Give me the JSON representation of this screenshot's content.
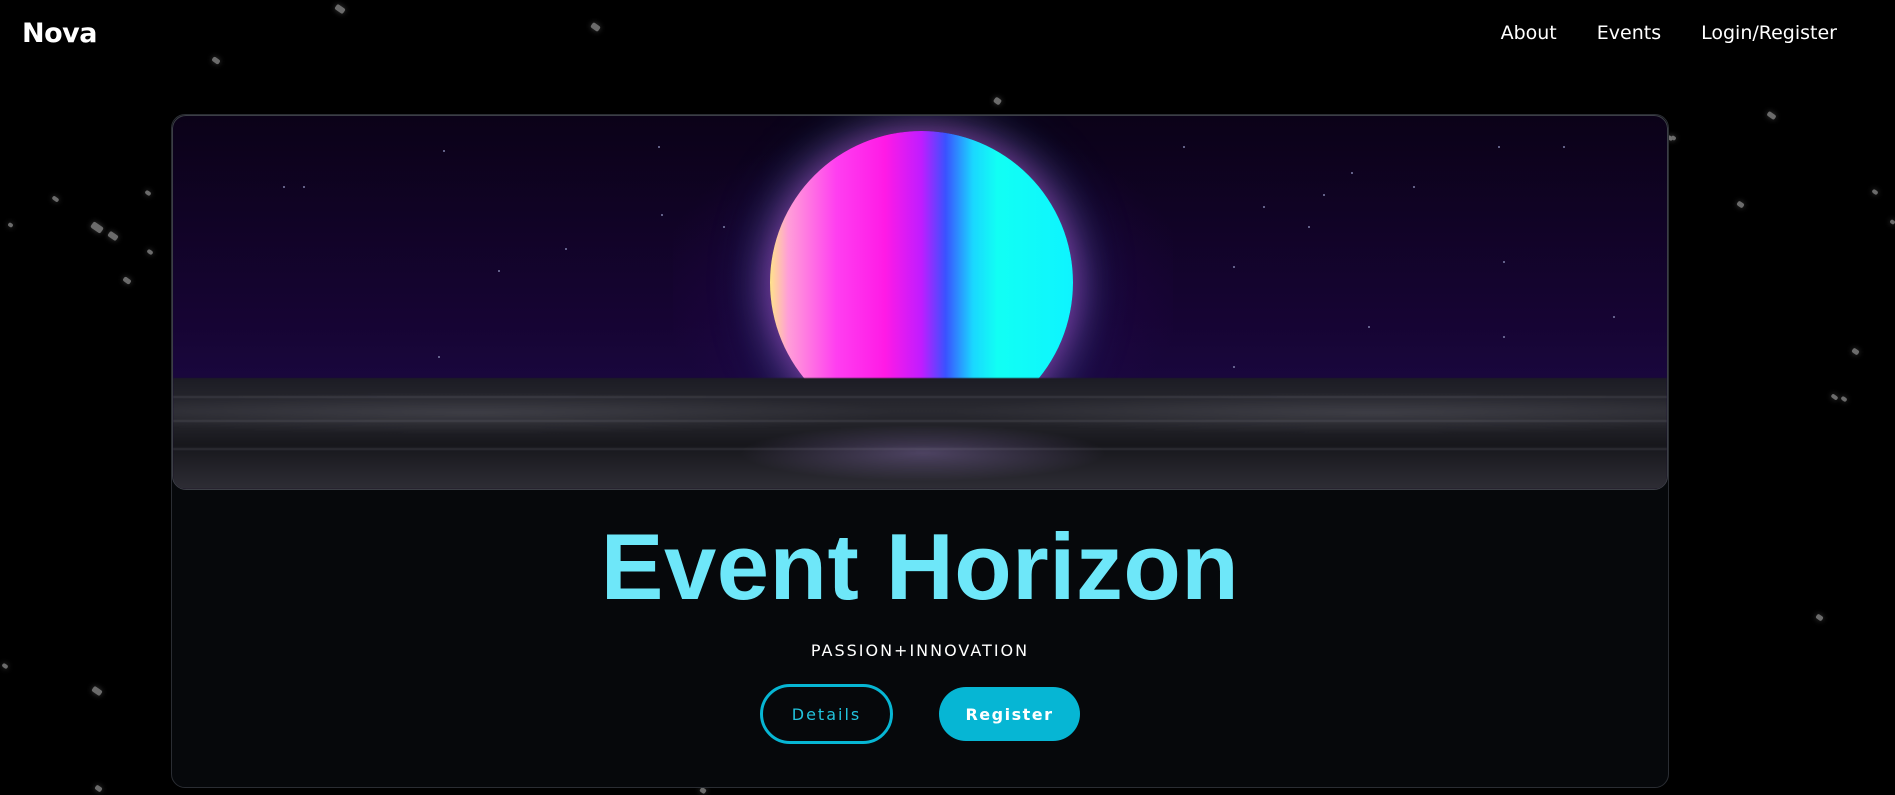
{
  "nav": {
    "brand": "Nova",
    "links": [
      {
        "label": "About"
      },
      {
        "label": "Events"
      },
      {
        "label": "Login/Register"
      }
    ]
  },
  "event": {
    "title": "Event Horizon",
    "tagline": "PASSION+INNOVATION",
    "details_label": "Details",
    "register_label": "Register"
  },
  "colors": {
    "background": "#000000",
    "title": "#6ee7f9",
    "accent": "#06b6d4"
  }
}
